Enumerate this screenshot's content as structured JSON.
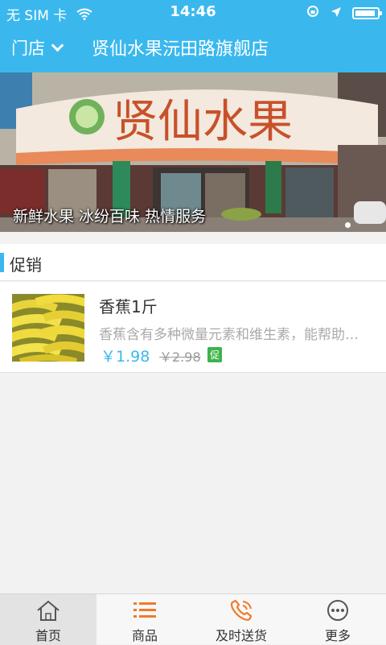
{
  "status_bar": {
    "carrier": "无 SIM 卡",
    "time": "14:46",
    "battery_level": 0.92
  },
  "nav": {
    "store_switch_label": "门店",
    "title": "贤仙水果沅田路旗舰店"
  },
  "banner": {
    "caption": "新鲜水果 冰纷百味 热情服务",
    "sign_text": "贤仙水果",
    "slide_count": 1,
    "active_slide": 1
  },
  "promo": {
    "section_title": "促销",
    "items": [
      {
        "name": "香蕉1斤",
        "description": "香蕉含有多种微量元素和维生素，能帮助肌肉松弛",
        "price": "￥1.98",
        "original_price": "￥2.98",
        "tag": "促"
      }
    ]
  },
  "tabbar": {
    "items": [
      {
        "label": "首页",
        "icon": "home-icon",
        "active": true
      },
      {
        "label": "商品",
        "icon": "list-icon",
        "active": false
      },
      {
        "label": "及时送货",
        "icon": "phone-icon",
        "active": false
      },
      {
        "label": "更多",
        "icon": "more-icon",
        "active": false
      }
    ]
  },
  "colors": {
    "accent": "#3ab8ee",
    "tag_green": "#3cb34a",
    "text_muted": "#aaaaaa"
  }
}
